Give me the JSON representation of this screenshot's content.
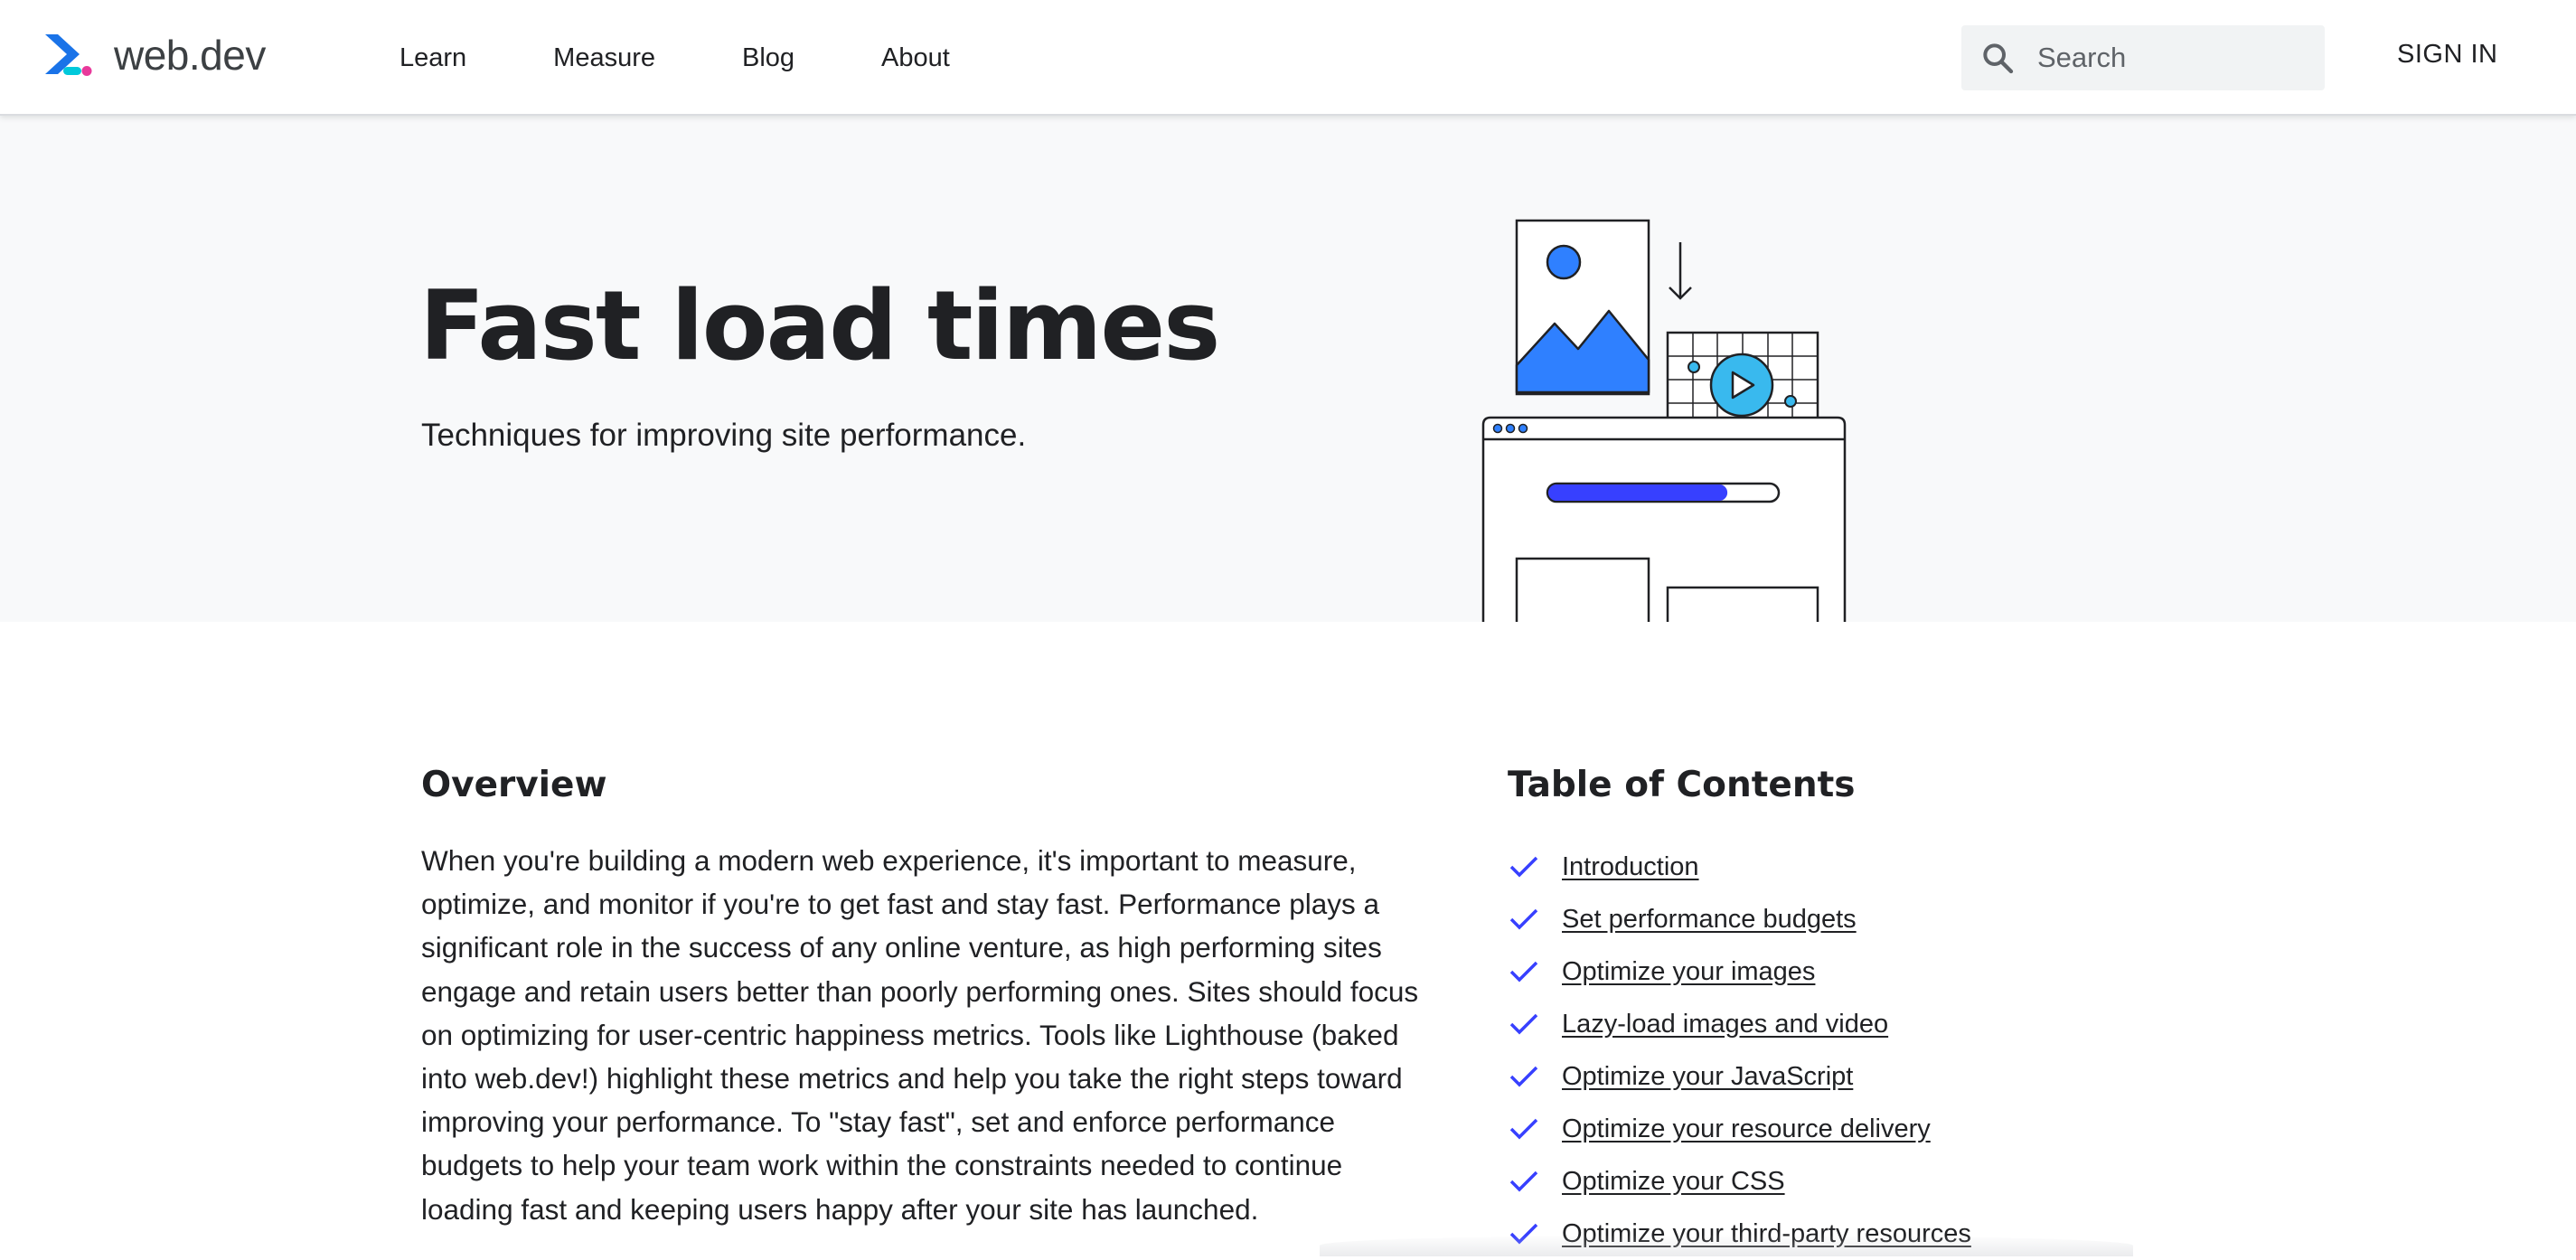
{
  "header": {
    "logo_text": "web.dev",
    "nav": [
      {
        "label": "Learn"
      },
      {
        "label": "Measure"
      },
      {
        "label": "Blog"
      },
      {
        "label": "About"
      }
    ],
    "search": {
      "placeholder": "Search",
      "value": ""
    },
    "sign_in_label": "SIGN IN"
  },
  "hero": {
    "title": "Fast load times",
    "subtitle": "Techniques for improving site performance.",
    "illustration": {
      "icons": [
        "image-placeholder-icon",
        "download-arrow-icon",
        "video-play-icon",
        "browser-window-icon"
      ],
      "progress_fraction": 0.78
    }
  },
  "overview": {
    "heading": "Overview",
    "body": "When you're building a modern web experience, it's important to measure, optimize, and monitor if you're to get fast and stay fast. Performance plays a significant role in the success of any online venture, as high performing sites engage and retain users better than poorly performing ones. Sites should focus on optimizing for user-centric happiness metrics. Tools like Lighthouse (baked into web.dev!) highlight these metrics and help you take the right steps toward improving your performance. To \"stay fast\", set and enforce performance budgets to help your team work within the constraints needed to continue loading fast and keeping users happy after your site has launched."
  },
  "toc": {
    "heading": "Table of Contents",
    "items": [
      {
        "label": "Introduction"
      },
      {
        "label": "Set performance budgets"
      },
      {
        "label": "Optimize your images"
      },
      {
        "label": "Lazy-load images and video"
      },
      {
        "label": "Optimize your JavaScript"
      },
      {
        "label": "Optimize your resource delivery"
      },
      {
        "label": "Optimize your CSS"
      },
      {
        "label": "Optimize your third-party resources"
      }
    ]
  },
  "colors": {
    "brand_blue": "#1a73e8",
    "check_blue": "#3740ff",
    "hero_background": "#f8f9fa",
    "illustration_blue": "#2f80ff",
    "illustration_cyan": "#39b9ee",
    "progress_blue": "#3740ff"
  }
}
